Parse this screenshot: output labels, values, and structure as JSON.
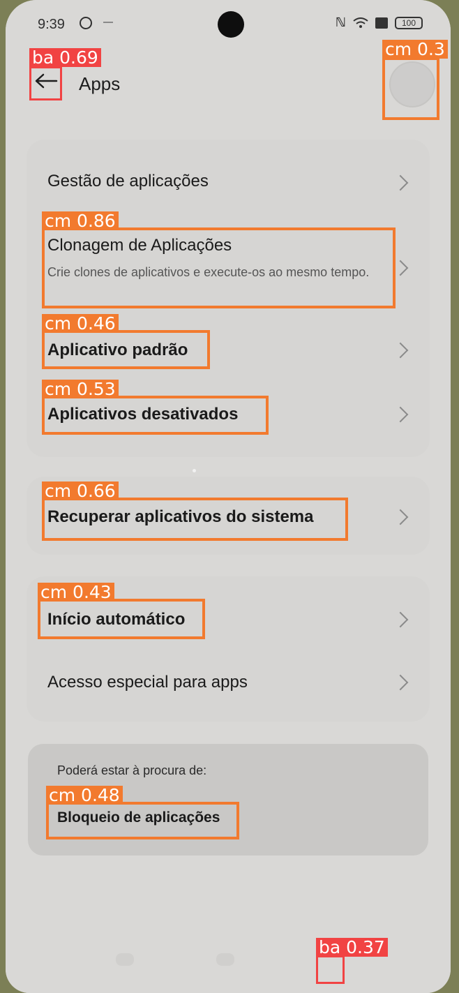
{
  "status_bar": {
    "time": "9:39",
    "battery": "100"
  },
  "header": {
    "title": "Apps"
  },
  "group1": {
    "items": [
      {
        "label": "Gestão de aplicações"
      },
      {
        "label": "Clonagem de Aplicações",
        "description": "Crie clones de aplicativos e execute-os ao mesmo tempo."
      },
      {
        "label": "Aplicativo padrão"
      },
      {
        "label": "Aplicativos desativados"
      }
    ]
  },
  "group2": {
    "items": [
      {
        "label": "Recuperar aplicativos do sistema"
      }
    ]
  },
  "group3": {
    "items": [
      {
        "label": "Início automático"
      },
      {
        "label": "Acesso especial para apps"
      }
    ]
  },
  "suggestions": {
    "heading": "Poderá estar à procura de:",
    "items": [
      {
        "label": "Bloqueio de aplicações"
      }
    ]
  },
  "detections": {
    "back": "ba 0.69",
    "avatar": "cm 0.3",
    "clone": "cm 0.86",
    "default_app": "cm 0.46",
    "disabled_apps": "cm 0.53",
    "recover": "cm 0.66",
    "autostart": "cm 0.43",
    "app_lock": "cm 0.48",
    "nav": "ba 0.37"
  },
  "colors": {
    "ba_box": "#f14343",
    "cm_box": "#f27a2e"
  }
}
